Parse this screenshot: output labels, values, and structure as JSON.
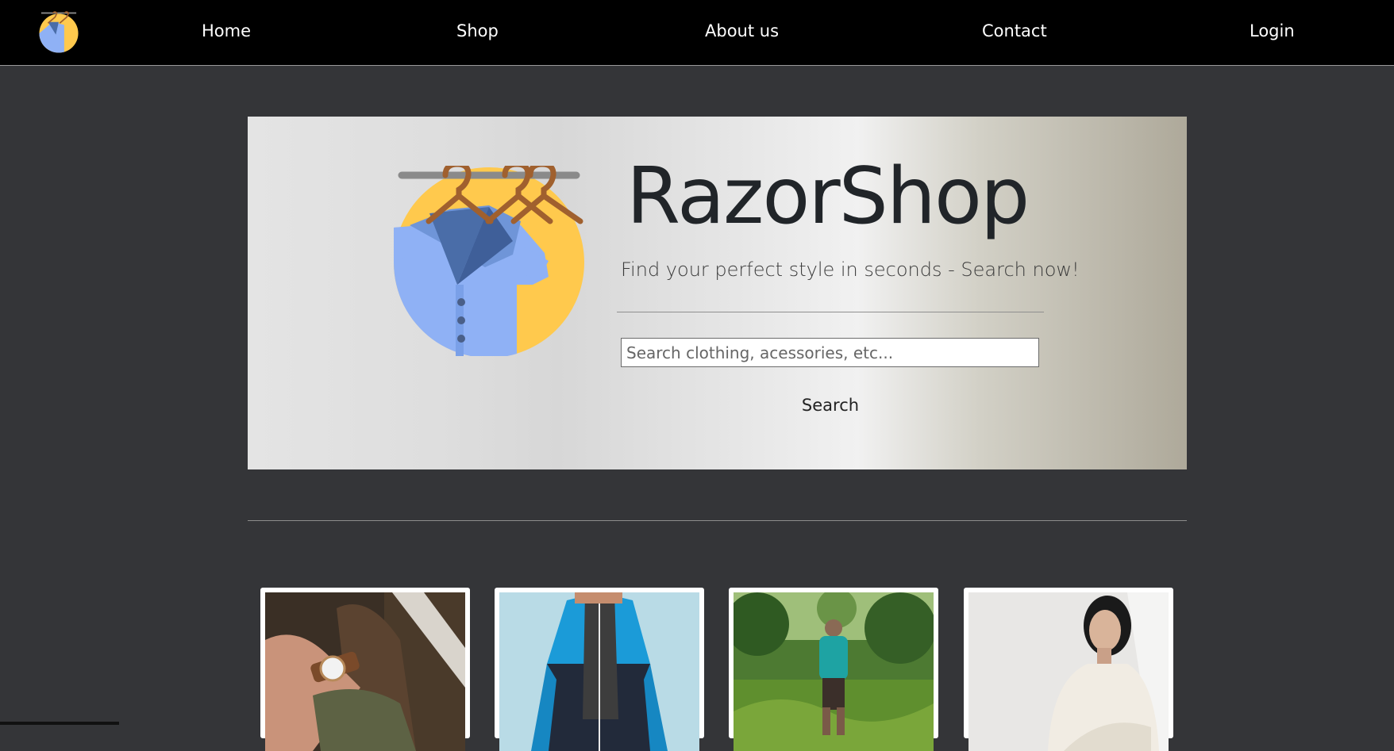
{
  "nav": {
    "items": [
      {
        "label": "Home"
      },
      {
        "label": "Shop"
      },
      {
        "label": "About us"
      },
      {
        "label": "Contact"
      },
      {
        "label": "Login"
      }
    ]
  },
  "hero": {
    "title": "RazorShop",
    "subtitle": "Find your perfect style in seconds - Search now!",
    "search_placeholder": "Search clothing, acessories, etc...",
    "search_button": "Search"
  },
  "colors": {
    "nav_bg": "#000000",
    "page_bg": "#343538",
    "logo_yellow": "#ffc94d",
    "logo_blue": "#8fb1f5",
    "hanger_brown": "#a0602e"
  },
  "products": [
    {
      "image": "wristwatch-photo"
    },
    {
      "image": "blue-jacket-photo"
    },
    {
      "image": "jungle-hiker-photo"
    },
    {
      "image": "white-sweater-photo"
    }
  ]
}
